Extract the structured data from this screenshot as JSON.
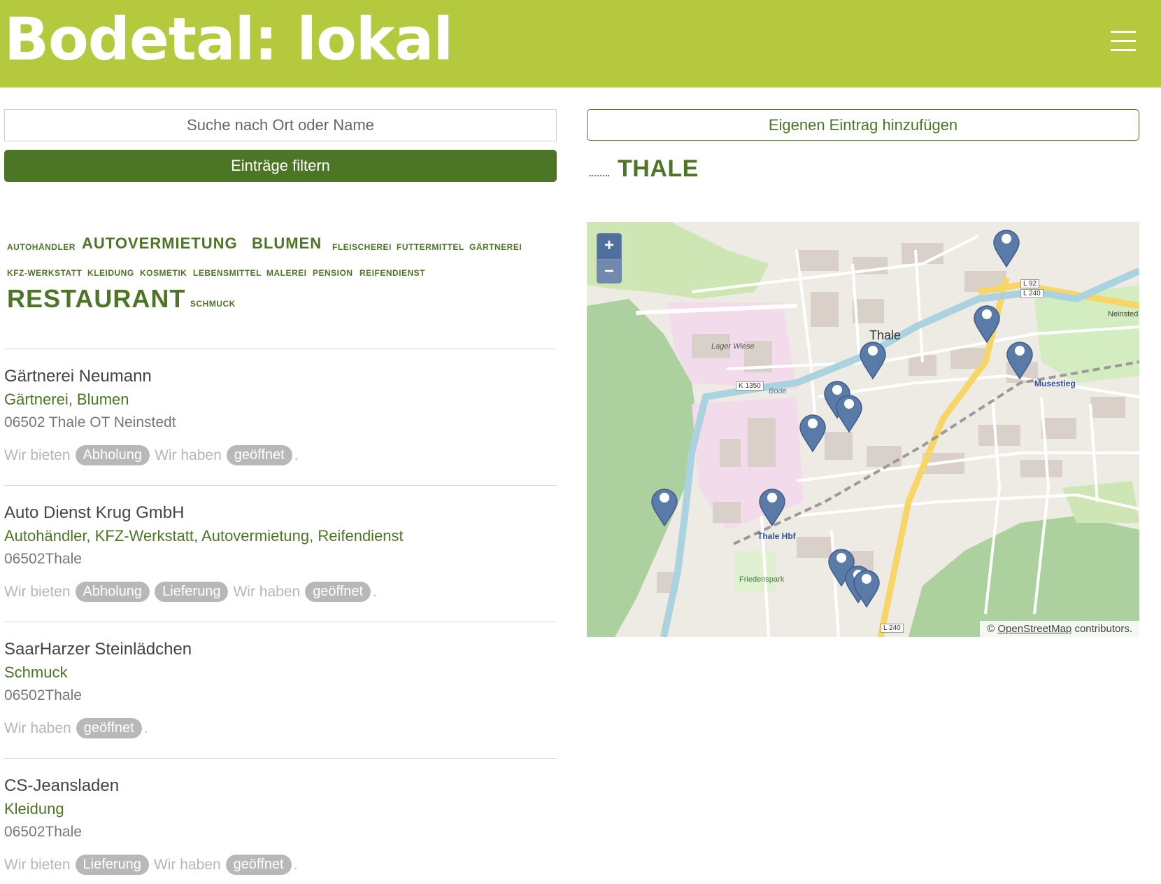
{
  "header": {
    "brand": "Bodetal: lokal",
    "menu_icon": "hamburger-menu-icon"
  },
  "search": {
    "placeholder": "Suche nach Ort oder Name",
    "value": ""
  },
  "filter_button": {
    "label": "Einträge filtern"
  },
  "add_button": {
    "label": "Eigenen Eintrag hinzufügen"
  },
  "city": {
    "title": "THALE"
  },
  "tags": [
    "AUTOHÄNDLER",
    "AUTOVERMIETUNG",
    "BLUMEN",
    "FLEISCHEREI",
    "FUTTERMITTEL",
    "GÄRTNEREI",
    "KFZ-WERKSTATT",
    "KLEIDUNG",
    "KOSMETIK",
    "LEBENSMITTEL",
    "MALEREI",
    "PENSION",
    "REIFENDIENST",
    "RESTAURANT",
    "SCHMUCK"
  ],
  "entries": [
    {
      "name": "Gärtnerei Neumann",
      "categories": "Gärtnerei, Blumen",
      "address": "06502 Thale OT Neinstedt",
      "offer_prefix": "Wir bieten",
      "offers": [
        "Abholung"
      ],
      "status_prefix": "Wir haben",
      "status": "geöffnet",
      "end": "."
    },
    {
      "name": "Auto Dienst Krug GmbH",
      "categories": "Autohändler, KFZ-Werkstatt, Autovermietung, Reifendienst",
      "address": "06502Thale",
      "offer_prefix": "Wir bieten",
      "offers": [
        "Abholung",
        "Lieferung"
      ],
      "status_prefix": "Wir haben",
      "status": "geöffnet",
      "end": "."
    },
    {
      "name": "SaarHarzer Steinlädchen",
      "categories": "Schmuck",
      "address": "06502Thale",
      "status_prefix": "Wir haben",
      "status": "geöffnet",
      "end": "."
    },
    {
      "name": "CS-Jeansladen",
      "categories": "Kleidung",
      "address": "06502Thale",
      "offer_prefix": "Wir bieten",
      "offers": [
        "Lieferung"
      ],
      "status_prefix": "Wir haben",
      "status": "geöffnet",
      "end": "."
    }
  ],
  "map": {
    "zoom_in": "+",
    "zoom_out": "−",
    "attribution_prefix": "©",
    "attribution_link": "OpenStreetMap",
    "attribution_suffix": "contributors.",
    "labels": {
      "town": "Thale",
      "station": "Thale Hbf",
      "park": "Friedenspark",
      "meadow": "Lager Wiese",
      "river": "Bode",
      "road1": "K 1350",
      "road2": "L 92",
      "road3": "L 240",
      "road4": "L 240",
      "stop": "Musestieg",
      "area": "Neinsted"
    },
    "colors": {
      "marker": "#5a7aa8",
      "water": "#aad3df",
      "forest": "#cfe5b5",
      "industrial": "#f2dcec",
      "main_road": "#f7d567"
    }
  }
}
